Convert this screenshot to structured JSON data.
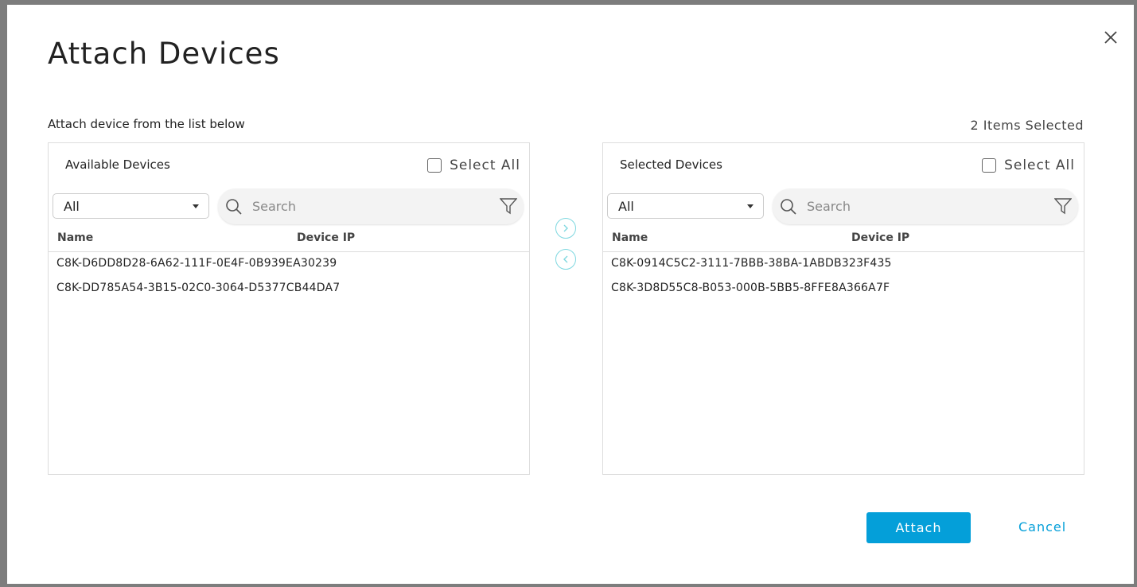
{
  "modal": {
    "title": "Attach Devices",
    "subtitle": "Attach device from the list below",
    "selected_count": "2 Items Selected"
  },
  "available": {
    "title": "Available Devices",
    "select_all": "Select All",
    "filter_value": "All",
    "search_placeholder": "Search",
    "columns": [
      "Name",
      "Device IP"
    ],
    "rows": [
      "C8K-D6DD8D28-6A62-111F-0E4F-0B939EA30239",
      "C8K-DD785A54-3B15-02C0-3064-D5377CB44DA7"
    ]
  },
  "selected": {
    "title": "Selected Devices",
    "select_all": "Select All",
    "filter_value": "All",
    "search_placeholder": "Search",
    "columns": [
      "Name",
      "Device IP"
    ],
    "rows": [
      "C8K-0914C5C2-3111-7BBB-38BA-1ABDB323F435",
      "C8K-3D8D55C8-B053-000B-5BB5-8FFE8A366A7F"
    ]
  },
  "buttons": {
    "attach": "Attach",
    "cancel": "Cancel"
  },
  "colors": {
    "accent": "#049fd9",
    "arrow": "#7fd8e0"
  }
}
